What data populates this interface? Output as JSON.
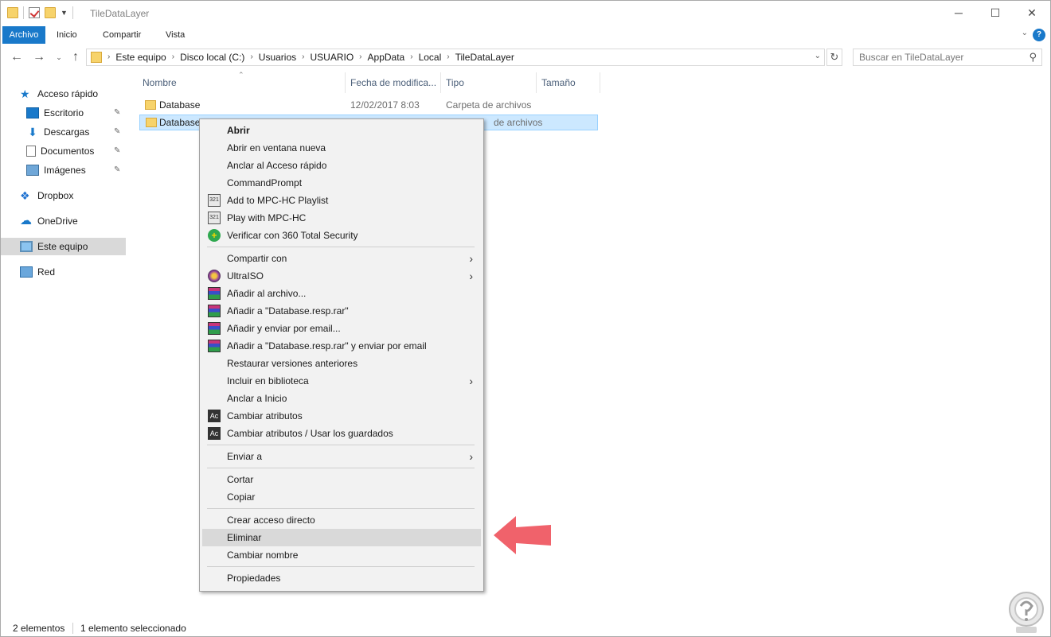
{
  "window": {
    "title": "TileDataLayer",
    "controls": {
      "minimize": "─",
      "maximize": "☐",
      "close": "✕"
    }
  },
  "ribbon": {
    "tabs": [
      "Archivo",
      "Inicio",
      "Compartir",
      "Vista"
    ],
    "help": "?"
  },
  "nav_buttons": {
    "back": "←",
    "forward": "→",
    "recent": "⌄",
    "up": "↑",
    "refresh": "↻"
  },
  "address": {
    "crumbs": [
      "Este equipo",
      "Disco local (C:)",
      "Usuarios",
      "USUARIO",
      "AppData",
      "Local",
      "TileDataLayer"
    ],
    "separator": "›"
  },
  "search": {
    "placeholder": "Buscar en TileDataLayer",
    "icon": "search-icon"
  },
  "sidebar": {
    "items": [
      {
        "label": "Acceso rápido",
        "icon": "star-icon",
        "pinned": false
      },
      {
        "label": "Escritorio",
        "icon": "desktop-icon",
        "pinned": true
      },
      {
        "label": "Descargas",
        "icon": "download-icon",
        "pinned": true
      },
      {
        "label": "Documentos",
        "icon": "document-icon",
        "pinned": true
      },
      {
        "label": "Imágenes",
        "icon": "images-icon",
        "pinned": true
      },
      {
        "label": "Dropbox",
        "icon": "dropbox-icon",
        "pinned": false
      },
      {
        "label": "OneDrive",
        "icon": "cloud-icon",
        "pinned": false
      },
      {
        "label": "Este equipo",
        "icon": "computer-icon",
        "pinned": false,
        "selected": true
      },
      {
        "label": "Red",
        "icon": "network-icon",
        "pinned": false
      }
    ],
    "pin_glyph": "📌"
  },
  "columns": [
    "Nombre",
    "Fecha de modifica...",
    "Tipo",
    "Tamaño"
  ],
  "files": [
    {
      "name": "Database",
      "date": "12/02/2017 8:03",
      "type": "Carpeta de archivos",
      "size": ""
    },
    {
      "name": "Database.",
      "date": "",
      "type": "de archivos",
      "size": "",
      "selected": true
    }
  ],
  "status": {
    "count": "2 elementos",
    "selection": "1 elemento seleccionado"
  },
  "context_menu": {
    "items": [
      {
        "label": "Abrir",
        "bold": true
      },
      {
        "label": "Abrir en ventana nueva"
      },
      {
        "label": "Anclar al Acceso rápido"
      },
      {
        "label": "CommandPrompt"
      },
      {
        "label": "Add to MPC-HC Playlist",
        "icon": "mpc-icon"
      },
      {
        "label": "Play with MPC-HC",
        "icon": "mpc-icon"
      },
      {
        "label": "Verificar con 360 Total Security",
        "icon": "security-icon"
      },
      {
        "label": "Compartir con",
        "submenu": true
      },
      {
        "label": "UltraISO",
        "submenu": true,
        "icon": "ultraiso-icon"
      },
      {
        "label": "Añadir al archivo...",
        "icon": "winrar-icon"
      },
      {
        "label": "Añadir a \"Database.resp.rar\"",
        "icon": "winrar-icon"
      },
      {
        "label": "Añadir y enviar por email...",
        "icon": "winrar-icon"
      },
      {
        "label": "Añadir a \"Database.resp.rar\" y enviar por email",
        "icon": "winrar-icon"
      },
      {
        "label": "Restaurar versiones anteriores"
      },
      {
        "label": "Incluir en biblioteca",
        "submenu": true
      },
      {
        "label": "Anclar a Inicio"
      },
      {
        "label": "Cambiar atributos",
        "icon": "attributes-icon"
      },
      {
        "label": "Cambiar atributos / Usar los guardados",
        "icon": "attributes-icon"
      },
      {
        "label": "Enviar a",
        "submenu": true
      },
      {
        "label": "Cortar"
      },
      {
        "label": "Copiar"
      },
      {
        "label": "Crear acceso directo"
      },
      {
        "label": "Eliminar",
        "highlighted": true
      },
      {
        "label": "Cambiar nombre"
      },
      {
        "label": "Propiedades"
      }
    ],
    "submenu_glyph": "›",
    "mpc_icon_text": "321",
    "secure_icon_text": "+",
    "ac_icon_text": "Ac"
  },
  "colors": {
    "accent": "#1979ca",
    "selection": "#cce8ff",
    "menu_bg": "#f2f2f2",
    "arrow": "#f0626b"
  }
}
